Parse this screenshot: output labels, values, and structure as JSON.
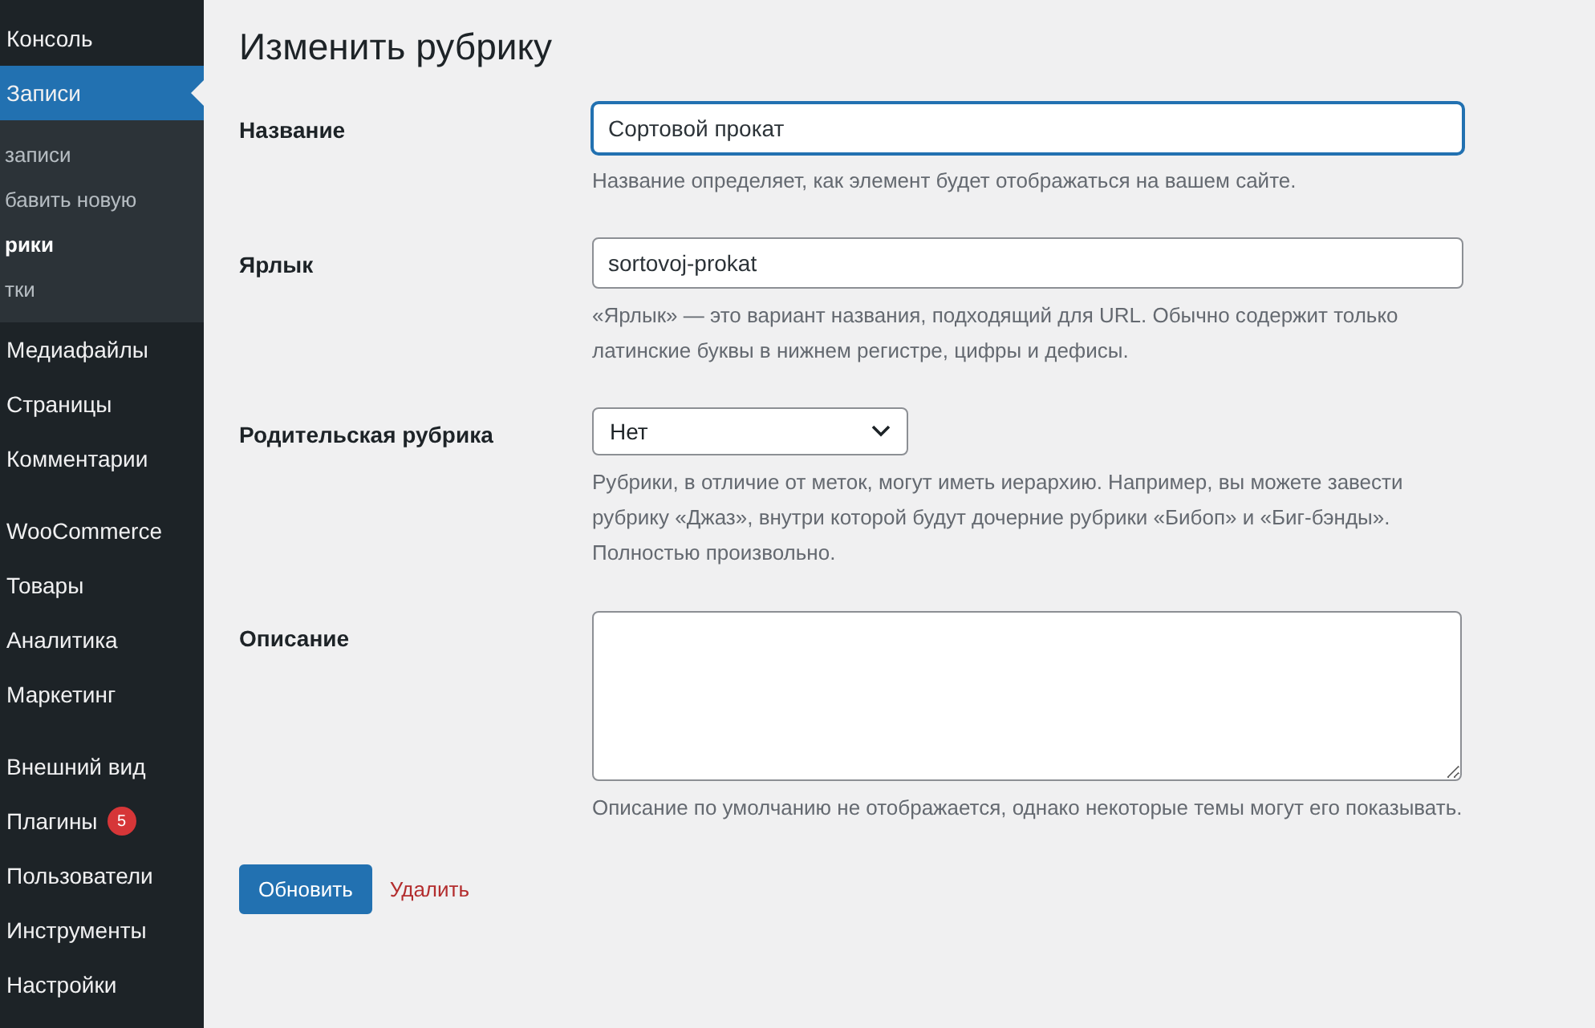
{
  "sidebar": {
    "groups": [
      {
        "items": [
          {
            "label": "Консоль",
            "selected": false
          },
          {
            "label": "Записи",
            "selected": true,
            "children": [
              {
                "label": "записи",
                "selected": false
              },
              {
                "label": "бавить новую",
                "selected": false
              },
              {
                "label": "рики",
                "selected": true
              },
              {
                "label": "тки",
                "selected": false
              }
            ]
          },
          {
            "label": "Медиафайлы",
            "selected": false
          },
          {
            "label": "Страницы",
            "selected": false
          },
          {
            "label": "Комментарии",
            "selected": false
          }
        ]
      },
      {
        "items": [
          {
            "label": "WooCommerce",
            "selected": false
          },
          {
            "label": "Товары",
            "selected": false
          },
          {
            "label": "Аналитика",
            "selected": false
          },
          {
            "label": "Маркетинг",
            "selected": false
          }
        ]
      },
      {
        "items": [
          {
            "label": "Внешний вид",
            "selected": false
          },
          {
            "label": "Плагины",
            "selected": false,
            "badge": "5"
          },
          {
            "label": "Пользователи",
            "selected": false
          },
          {
            "label": "Инструменты",
            "selected": false
          },
          {
            "label": "Настройки",
            "selected": false
          }
        ]
      }
    ]
  },
  "page": {
    "title": "Изменить рубрику",
    "fields": [
      {
        "kind": "text",
        "label": "Название",
        "value": "Сортовой прокат",
        "focused": true,
        "help": "Название определяет, как элемент будет отображаться на вашем сайте."
      },
      {
        "kind": "text",
        "label": "Ярлык",
        "value": "sortovoj-prokat",
        "focused": false,
        "help": "«Ярлык» — это вариант названия, подходящий для URL. Обычно содержит только латинские буквы в нижнем регистре, цифры и дефисы."
      },
      {
        "kind": "select",
        "label": "Родительская рубрика",
        "value": "Нет",
        "focused": false,
        "help": "Рубрики, в отличие от меток, могут иметь иерархию. Например, вы можете завести рубрику «Джаз», внутри которой будут дочерние рубрики «Бибоп» и «Биг-бэнды». Полностью произвольно."
      },
      {
        "kind": "textarea",
        "label": "Описание",
        "focused": false,
        "help": "Описание по умолчанию не отображается, однако некоторые темы могут его показывать."
      }
    ],
    "update_button": "Обновить",
    "delete_link": "Удалить"
  }
}
